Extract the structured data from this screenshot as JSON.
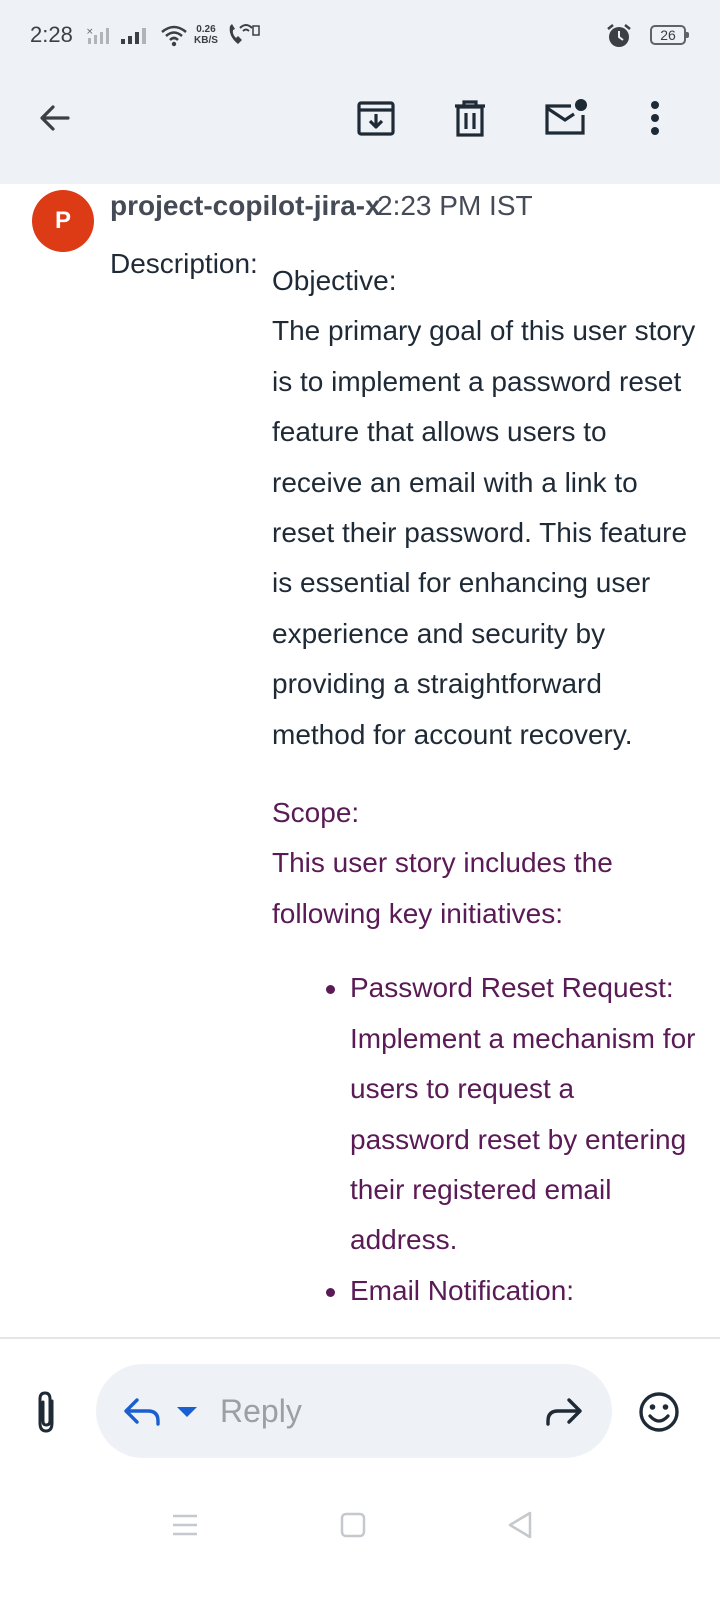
{
  "status_bar": {
    "time": "2:28",
    "net_speed_value": "0.26",
    "net_speed_unit": "KB/S",
    "battery": "26"
  },
  "toolbar": {
    "icons": [
      "back-arrow-icon",
      "archive-icon",
      "delete-icon",
      "mark-unread-icon",
      "more-vert-icon"
    ]
  },
  "message": {
    "avatar_letter": "P",
    "sender": "project-copilot-jira-x",
    "time": "2:23 PM IST",
    "description_label": "Description:",
    "objective_heading": "Objective:",
    "objective_text": "The primary goal of this user story is to implement a password reset feature that allows users to receive an email with a link to reset their password. This feature is essential for enhancing user experience and security by providing a straightforward method for account recovery.",
    "scope_heading": "Scope:",
    "scope_text": "This user story includes the following key initiatives:",
    "bullets": [
      "Password Reset Request: Implement a mechanism for users to request a password reset by entering their registered email address.",
      "Email Notification:"
    ]
  },
  "composer": {
    "reply_placeholder": "Reply"
  },
  "colors": {
    "toolbar_bg": "#eef1f6",
    "avatar_bg": "#dd3a16",
    "quoted_text": "#5a1a55",
    "accent_blue": "#1a5fd0"
  }
}
